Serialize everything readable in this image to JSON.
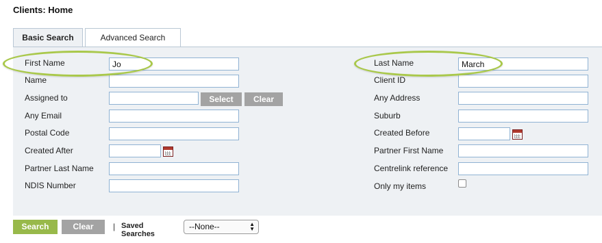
{
  "page": {
    "title": "Clients: Home"
  },
  "tabs": [
    {
      "label": "Basic Search",
      "active": true
    },
    {
      "label": "Advanced Search",
      "active": false
    }
  ],
  "form": {
    "left": {
      "first_name": {
        "label": "First Name",
        "value": "Jo"
      },
      "name": {
        "label": "Name",
        "value": ""
      },
      "assigned_to": {
        "label": "Assigned to",
        "value": "",
        "select_label": "Select",
        "clear_label": "Clear"
      },
      "any_email": {
        "label": "Any Email",
        "value": ""
      },
      "postal_code": {
        "label": "Postal Code",
        "value": ""
      },
      "created_after": {
        "label": "Created After",
        "value": ""
      },
      "partner_last_name": {
        "label": "Partner Last Name",
        "value": ""
      },
      "ndis_number": {
        "label": "NDIS Number",
        "value": ""
      }
    },
    "right": {
      "last_name": {
        "label": "Last Name",
        "value": "March"
      },
      "client_id": {
        "label": "Client ID",
        "value": ""
      },
      "any_address": {
        "label": "Any Address",
        "value": ""
      },
      "suburb": {
        "label": "Suburb",
        "value": ""
      },
      "created_before": {
        "label": "Created Before",
        "value": ""
      },
      "partner_first_name": {
        "label": "Partner First Name",
        "value": ""
      },
      "centrelink_reference": {
        "label": "Centrelink reference",
        "value": ""
      },
      "only_my_items": {
        "label": "Only my items",
        "checked": false
      }
    }
  },
  "actions": {
    "search_label": "Search",
    "clear_label": "Clear",
    "separator": "|",
    "saved_searches_label": "Saved Searches",
    "saved_searches_value": "--None--"
  },
  "colors": {
    "highlight_oval": "#a9c84a",
    "search_button": "#98b94a",
    "gray_button": "#a3a3a3",
    "panel_bg": "#eef1f4",
    "input_border": "#8fb2d3"
  },
  "icons": {
    "date_picker": "calendar-icon",
    "dropdown": "select-arrows-icon"
  }
}
